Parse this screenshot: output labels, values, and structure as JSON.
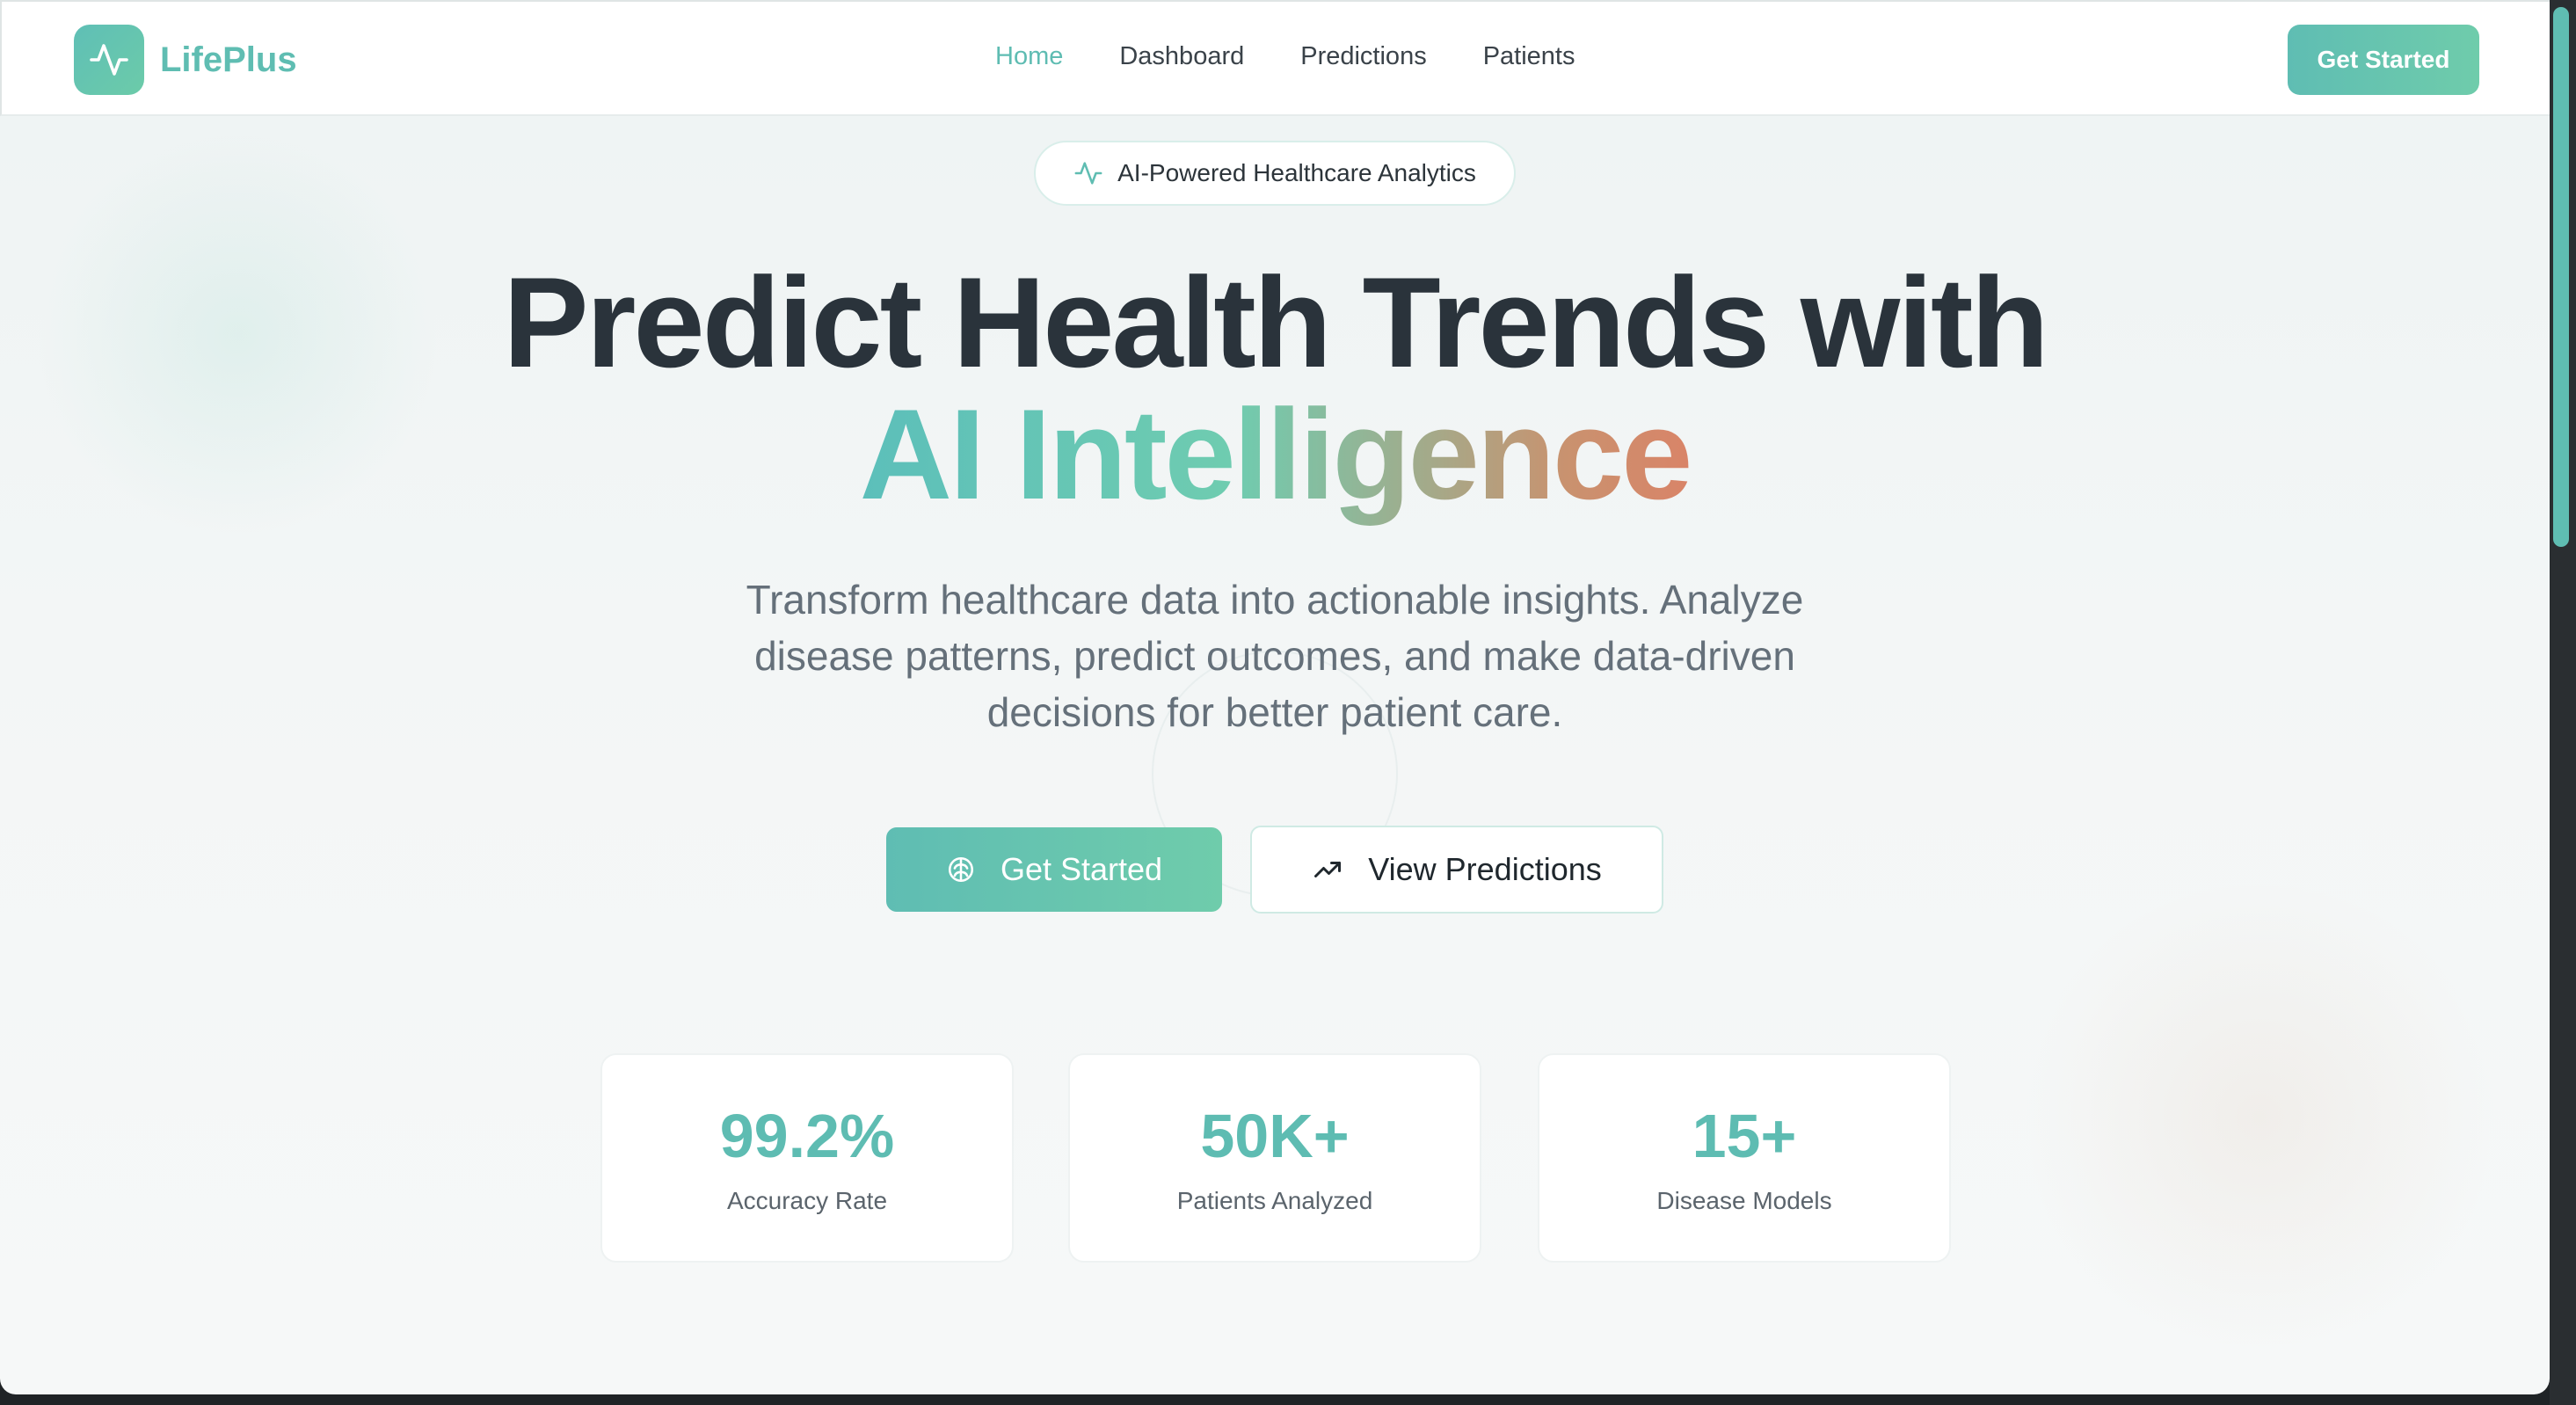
{
  "app": {
    "name": "LifePlus",
    "logo_icon": "activity-pulse-icon",
    "colors": {
      "brand": "#5fbdb2",
      "brand_end": "#6fccab",
      "heading": "#2a333b",
      "accent_warm": "#d98468"
    }
  },
  "nav": {
    "links": [
      {
        "label": "Home",
        "active": true
      },
      {
        "label": "Dashboard",
        "active": false
      },
      {
        "label": "Predictions",
        "active": false
      },
      {
        "label": "Patients",
        "active": false
      }
    ],
    "cta_label": "Get Started"
  },
  "hero": {
    "badge": {
      "icon": "activity-pulse-icon",
      "text": "AI-Powered Healthcare Analytics"
    },
    "title_line1": "Predict Health Trends with",
    "title_line2": "AI Intelligence",
    "subtitle": "Transform healthcare data into actionable insights. Analyze disease patterns, predict outcomes, and make data-driven decisions for better patient care.",
    "primary_button": {
      "label": "Get Started",
      "icon": "brain-icon"
    },
    "secondary_button": {
      "label": "View Predictions",
      "icon": "trending-up-icon"
    }
  },
  "stats": [
    {
      "value": "99.2%",
      "label": "Accuracy Rate"
    },
    {
      "value": "50K+",
      "label": "Patients Analyzed"
    },
    {
      "value": "15+",
      "label": "Disease Models"
    }
  ]
}
